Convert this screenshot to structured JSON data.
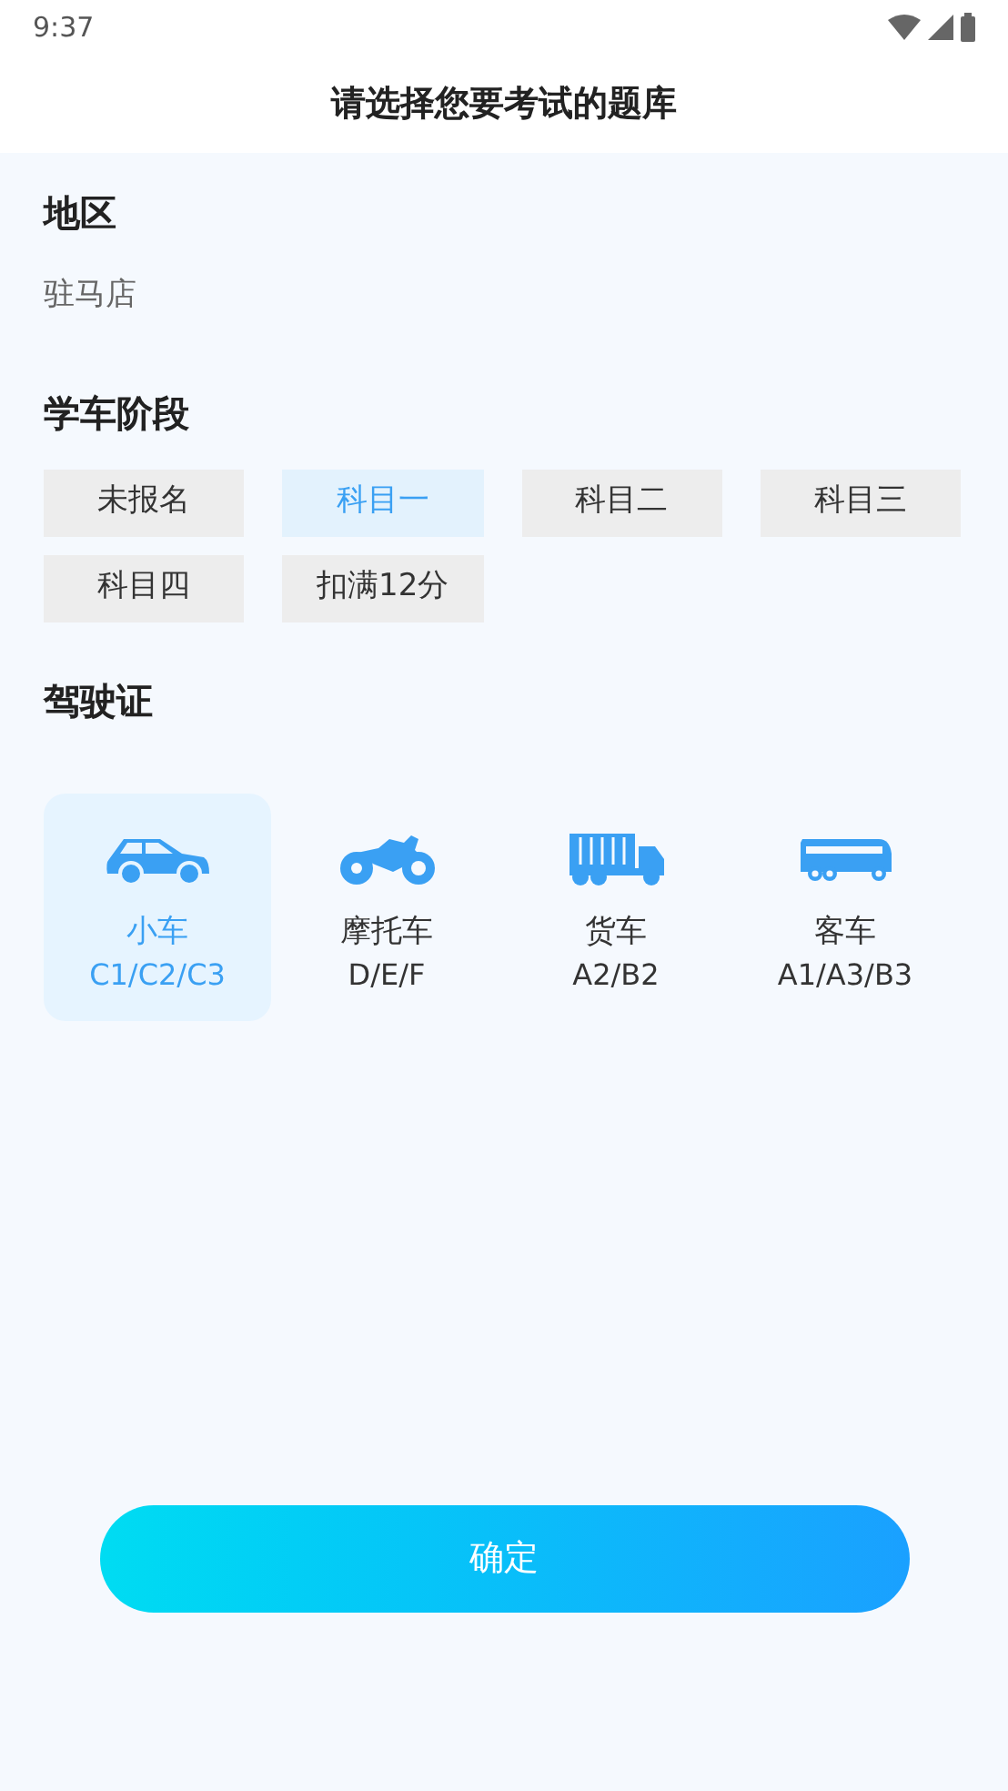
{
  "status_bar": {
    "time": "9:37"
  },
  "header": {
    "title": "请选择您要考试的题库"
  },
  "region": {
    "heading": "地区",
    "value": "驻马店"
  },
  "stage": {
    "heading": "学车阶段",
    "options": [
      {
        "label": "未报名",
        "selected": false
      },
      {
        "label": "科目一",
        "selected": true
      },
      {
        "label": "科目二",
        "selected": false
      },
      {
        "label": "科目三",
        "selected": false
      },
      {
        "label": "科目四",
        "selected": false
      },
      {
        "label": "扣满12分",
        "selected": false
      }
    ]
  },
  "license": {
    "heading": "驾驶证",
    "options": [
      {
        "kind": "car",
        "name": "小车",
        "classes": "C1/C2/C3",
        "selected": true
      },
      {
        "kind": "motorcycle",
        "name": "摩托车",
        "classes": "D/E/F",
        "selected": false
      },
      {
        "kind": "truck",
        "name": "货车",
        "classes": "A2/B2",
        "selected": false
      },
      {
        "kind": "bus",
        "name": "客车",
        "classes": "A1/A3/B3",
        "selected": false
      }
    ]
  },
  "confirm_button": {
    "label": "确定"
  }
}
